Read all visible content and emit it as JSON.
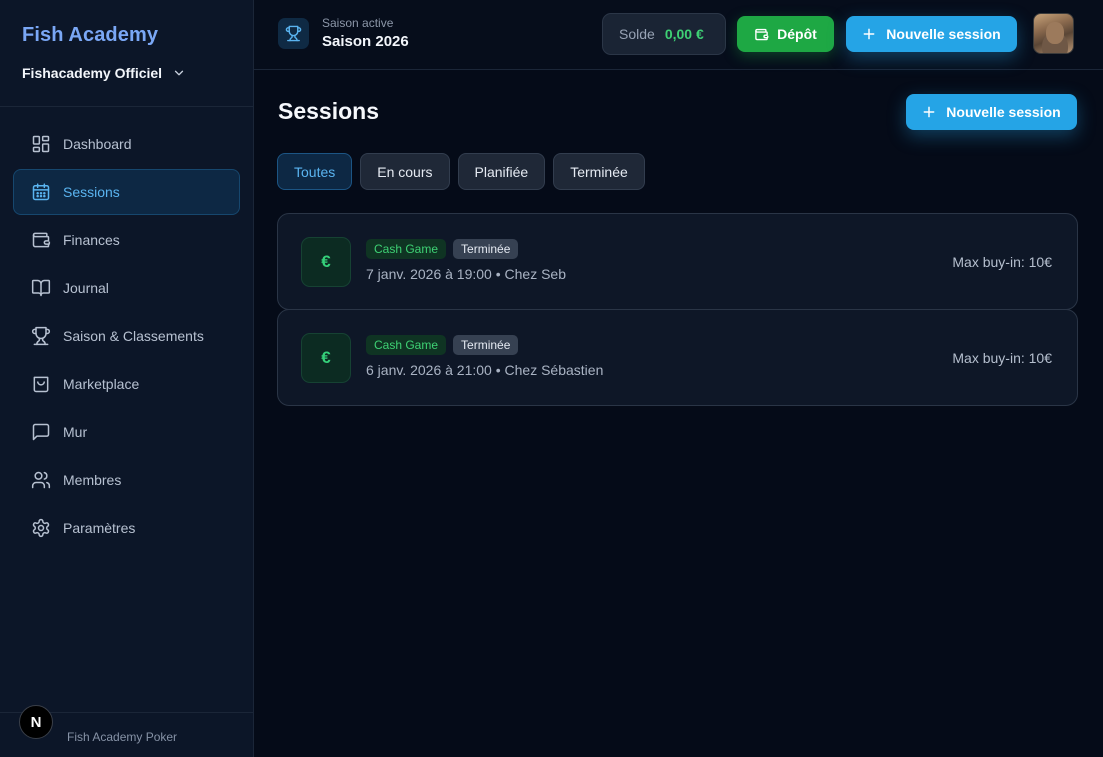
{
  "brand": {
    "title": "Fish Academy",
    "org": "Fishacademy Officiel"
  },
  "nav": [
    {
      "label": "Dashboard"
    },
    {
      "label": "Sessions"
    },
    {
      "label": "Finances"
    },
    {
      "label": "Journal"
    },
    {
      "label": "Saison & Classements"
    },
    {
      "label": "Marketplace"
    },
    {
      "label": "Mur"
    },
    {
      "label": "Membres"
    },
    {
      "label": "Paramètres"
    }
  ],
  "footer": {
    "text": "Fish Academy Poker",
    "badge": "N"
  },
  "topbar": {
    "season_label": "Saison active",
    "season_name": "Saison 2026",
    "solde_label": "Solde",
    "solde_value": "0,00 €",
    "depot_label": "Dépôt",
    "new_session_label": "Nouvelle session"
  },
  "main": {
    "title": "Sessions",
    "new_session_label": "Nouvelle session",
    "filters": [
      "Toutes",
      "En cours",
      "Planifiée",
      "Terminée"
    ],
    "sessions": [
      {
        "icon": "€",
        "type": "Cash Game",
        "status": "Terminée",
        "meta": "7 janv. 2026 à 19:00 • Chez Seb",
        "buyin": "Max buy-in: 10€"
      },
      {
        "icon": "€",
        "type": "Cash Game",
        "status": "Terminée",
        "meta": "6 janv. 2026 à 21:00 • Chez Sébastien",
        "buyin": "Max buy-in: 10€"
      }
    ]
  },
  "colors": {
    "accent": "#25a4e6",
    "success": "#1ea844",
    "brand": "#7aa7f5"
  }
}
